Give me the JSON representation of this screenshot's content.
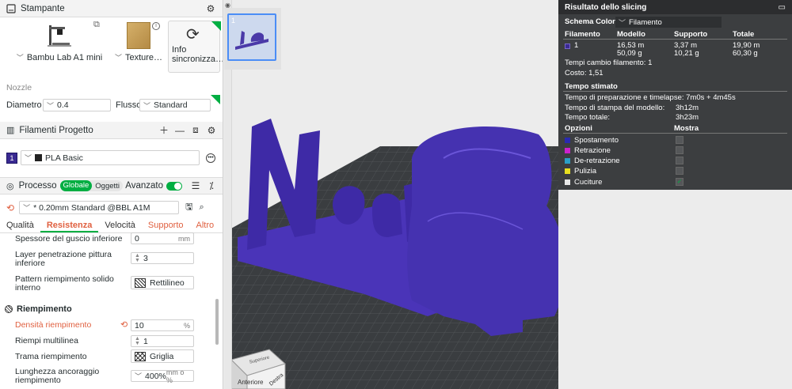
{
  "printer": {
    "title": "Stampante",
    "printer_name": "Bambu Lab A1 mini",
    "plate_name": "Texture…",
    "sync_label_1": "Info",
    "sync_label_2": "sincronizza…",
    "nozzle_label": "Nozzle",
    "diameter_label": "Diametro",
    "diameter_value": "0.4",
    "flow_label": "Flusso",
    "flow_value": "Standard"
  },
  "filaments": {
    "title": "Filamenti Progetto",
    "items": [
      {
        "index": "1",
        "name": "PLA Basic",
        "color": "#3a2a92"
      }
    ]
  },
  "process": {
    "title": "Processo",
    "global_label": "Globale",
    "objects_label": "Oggetti",
    "advanced_label": "Avanzato",
    "profile": "* 0.20mm Standard @BBL A1M",
    "tabs": [
      "Qualità",
      "Resistenza",
      "Velocità",
      "Supporto",
      "Altro"
    ],
    "params": {
      "bottom_shell_label": "Spessore del guscio inferiore",
      "bottom_shell_value": "0",
      "bottom_shell_unit": "mm",
      "paint_layers_label_1": "Layer penetrazione pittura",
      "paint_layers_label_2": "inferiore",
      "paint_layers_value": "3",
      "solid_pattern_label_1": "Pattern riempimento solido",
      "solid_pattern_label_2": "interno",
      "solid_pattern_value": "Rettilineo",
      "infill_section": "Riempimento",
      "density_label": "Densità riempimento",
      "density_value": "10",
      "density_unit": "%",
      "multiline_label": "Riempi multilinea",
      "multiline_value": "1",
      "pattern_label": "Trama riempimento",
      "pattern_value": "Griglia",
      "anchor_label_1": "Lunghezza ancoraggio",
      "anchor_label_2": "riempimento",
      "anchor_value": "400%",
      "anchor_unit": "mm o %"
    }
  },
  "plate": {
    "thumb_number": "1"
  },
  "viewport": {
    "cube_top": "Superiore",
    "cube_front": "Anteriore",
    "cube_right": "Destra"
  },
  "slicing": {
    "title": "Risultato dello slicing",
    "color_scheme_label": "Schema Colore",
    "color_scheme_value": "Filamento",
    "columns": [
      "Filamento",
      "Modello",
      "Supporto",
      "Totale"
    ],
    "row": {
      "id": "1",
      "model_len": "16,53 m",
      "model_wt": "50,09 g",
      "support_len": "3,37 m",
      "support_wt": "10,21 g",
      "total_len": "19,90 m",
      "total_wt": "60,30 g"
    },
    "filament_changes": "Tempi cambio filamento:  1",
    "cost": "Costo:  1,51",
    "time_title": "Tempo stimato",
    "prep_time": "Tempo di preparazione e timelapse: 7m0s + 4m45s",
    "print_time_label": "Tempo di stampa del modello:",
    "print_time_value": "3h12m",
    "total_time_label": "Tempo totale:",
    "total_time_value": "3h23m",
    "options_label": "Opzioni",
    "show_label": "Mostra",
    "options": [
      {
        "name": "Spostamento",
        "color": "#2a2ab0",
        "checked": false
      },
      {
        "name": "Retrazione",
        "color": "#cc22cc",
        "checked": false
      },
      {
        "name": "De-retrazione",
        "color": "#2aa0c8",
        "checked": false
      },
      {
        "name": "Pulizia",
        "color": "#e8e020",
        "checked": false
      },
      {
        "name": "Cuciture",
        "color": "#e8e8e8",
        "checked": true
      }
    ]
  }
}
